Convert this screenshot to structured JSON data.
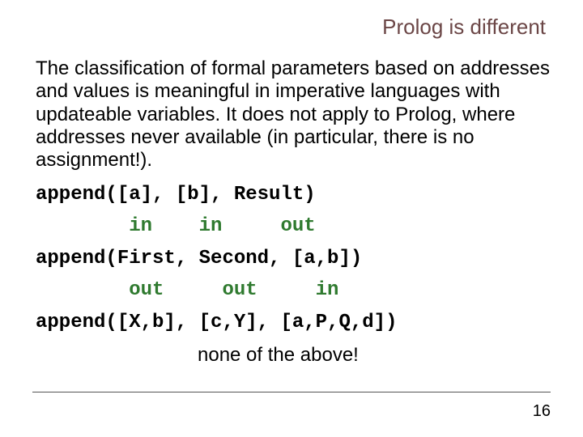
{
  "title": "Prolog is different",
  "body": "The classification of formal parameters based on addresses and values is meaningful in imperative languages with updateable variables. It does not apply to Prolog, where addresses never available (in particular, there is no assignment!).",
  "ex1_code": "append([a], [b], Result)",
  "ex1_anno": "        in    in     out",
  "ex2_code": "append(First, Second, [a,b])",
  "ex2_anno": "        out     out     in",
  "ex3_code": "append([X,b], [c,Y], [a,P,Q,d])",
  "ex3_anno": "none of the above!",
  "page_number": "16"
}
